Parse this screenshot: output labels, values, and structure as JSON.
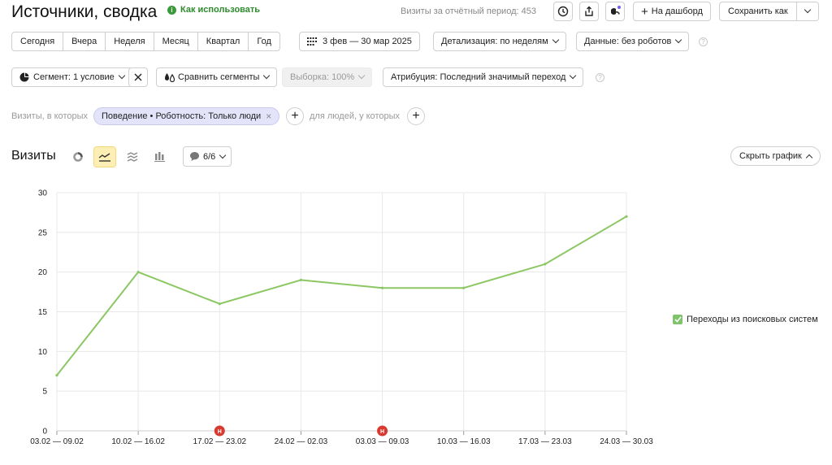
{
  "header": {
    "title": "Источники, сводка",
    "howto_label": "Как использовать",
    "howto_icon": "info-icon",
    "visits_period_text": "Визиты за отчётный период: 453",
    "add_dashboard_label": "На дашборд",
    "save_as_label": "Сохранить как"
  },
  "periods": [
    "Сегодня",
    "Вчера",
    "Неделя",
    "Месяц",
    "Квартал",
    "Год"
  ],
  "date_range": "3 фев — 30 мар 2025",
  "detail_label": "Детализация: по неделям",
  "data_label": "Данные: без роботов",
  "segment": {
    "label": "Сегмент: 1 условие",
    "compare_label": "Сравнить сегменты",
    "sample_label": "Выборка: 100%",
    "attribution_label": "Атрибуция: Последний значимый переход"
  },
  "filters": {
    "prefix": "Визиты, в которых",
    "chip": "Поведение • Роботность: Только люди",
    "people_label": "для людей, у которых"
  },
  "chart_section": {
    "title": "Визиты",
    "annotations_count": "6/6",
    "hide_chart_label": "Скрыть график"
  },
  "chart_data": {
    "type": "line",
    "categories": [
      "03.02 — 09.02",
      "10.02 — 16.02",
      "17.02 — 23.02",
      "24.02 — 02.03",
      "03.03 — 09.03",
      "10.03 — 16.03",
      "17.03 — 23.03",
      "24.03 — 30.03"
    ],
    "series": [
      {
        "name": "Переходы из поисковых систем",
        "values": [
          7,
          20,
          16,
          19,
          18,
          18,
          21,
          27
        ],
        "color": "#8cc764"
      }
    ],
    "ylim": [
      0,
      30
    ],
    "yticks": [
      0,
      5,
      10,
      15,
      20,
      25,
      30
    ],
    "grid": true,
    "legend_position": "right",
    "holiday_markers": [
      {
        "category_index": 2,
        "label": "Н"
      },
      {
        "category_index": 4,
        "label": "Н"
      }
    ]
  }
}
